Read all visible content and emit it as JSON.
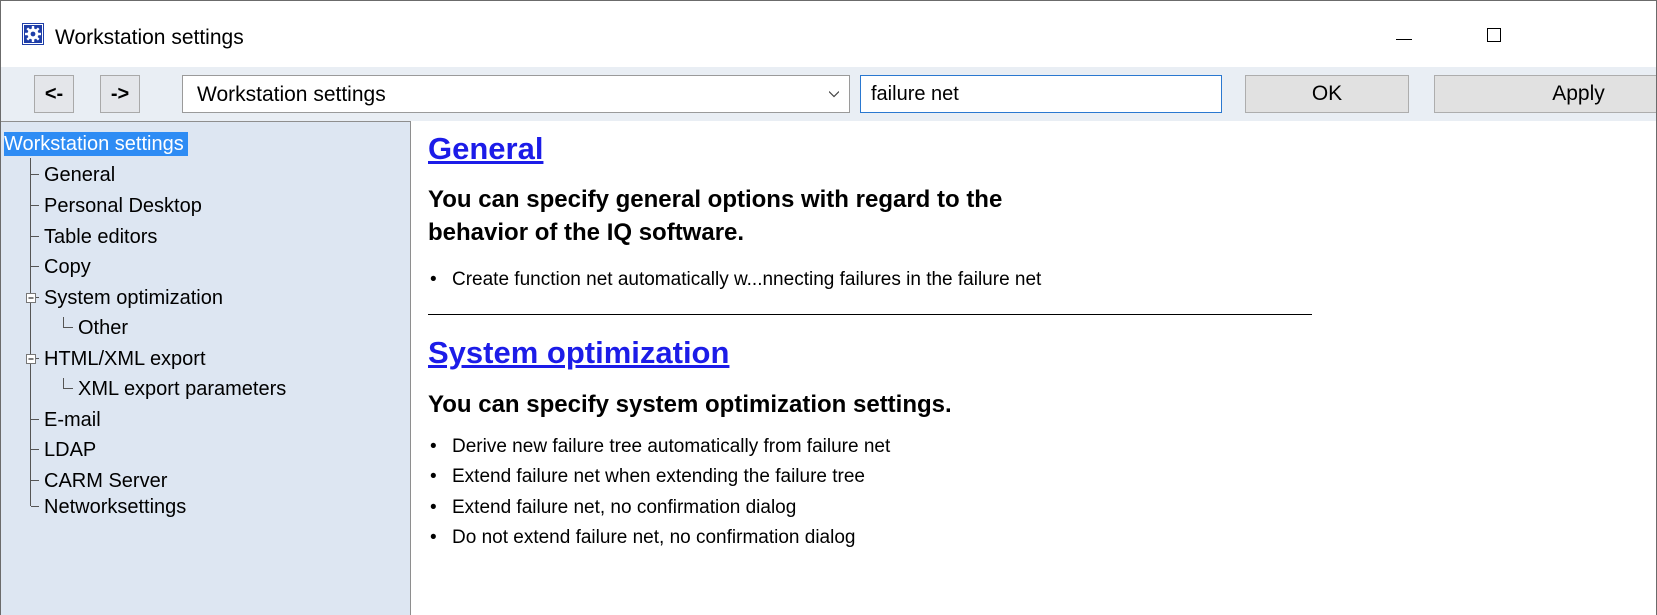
{
  "window": {
    "title": "Workstation settings",
    "icon": "settings-gear-icon",
    "minimize_glyph": "minimize",
    "maximize_glyph": "maximize"
  },
  "toolbar": {
    "back_label": "<-",
    "forward_label": "->",
    "path_value": "Workstation settings",
    "search_value": "failure net",
    "ok_label": "OK",
    "apply_label": "Apply"
  },
  "tree": {
    "root": "Workstation settings",
    "items": [
      {
        "label": "General"
      },
      {
        "label": "Personal Desktop"
      },
      {
        "label": "Table editors"
      },
      {
        "label": "Copy"
      },
      {
        "label": "System optimization"
      },
      {
        "label": "Other"
      },
      {
        "label": "HTML/XML export"
      },
      {
        "label": "XML export parameters"
      },
      {
        "label": "E-mail"
      },
      {
        "label": "LDAP"
      },
      {
        "label": "CARM Server"
      },
      {
        "label": "Networksettings"
      }
    ]
  },
  "content": {
    "sections": [
      {
        "title": "General",
        "description_line1": "You can specify general options with regard to the",
        "description_line2": "behavior of the IQ software.",
        "bullets": [
          "Create function net automatically w...nnecting failures in the failure net"
        ]
      },
      {
        "title": "System optimization",
        "description_line1": "You can specify system optimization settings.",
        "bullets": [
          "Derive new failure tree automatically from failure net",
          "Extend failure net when extending the failure tree",
          "Extend failure net, no confirmation dialog",
          "Do not extend failure net, no confirmation dialog"
        ]
      }
    ]
  },
  "colors": {
    "selection": "#2e8cf4",
    "link": "#1c1ce8",
    "tree_background": "#dde6f2",
    "toolbar_background": "#e9eef4"
  }
}
